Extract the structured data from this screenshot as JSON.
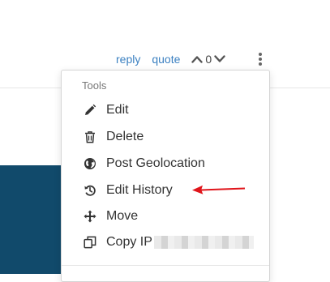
{
  "post_actions": {
    "reply_label": "reply",
    "quote_label": "quote",
    "vote_count": "0"
  },
  "tools_menu": {
    "header": "Tools",
    "items": [
      {
        "label": "Edit",
        "icon": "pencil-icon"
      },
      {
        "label": "Delete",
        "icon": "trash-icon"
      },
      {
        "label": "Post Geolocation",
        "icon": "globe-icon"
      },
      {
        "label": "Edit History",
        "icon": "history-icon"
      },
      {
        "label": "Move",
        "icon": "move-arrows-icon"
      },
      {
        "label": "Copy IP",
        "icon": "copy-icon"
      }
    ]
  },
  "colors": {
    "link": "#3b80c1",
    "annotation_arrow": "#e0151b",
    "panel": "#114a6b"
  }
}
